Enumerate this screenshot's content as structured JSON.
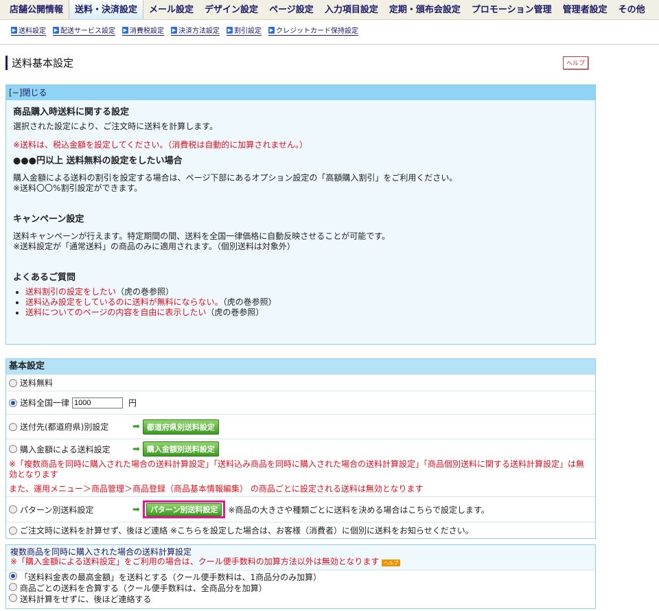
{
  "nav": {
    "tabs": [
      "店舗公開情報",
      "送料・決済設定",
      "メール設定",
      "デザイン設定",
      "ページ設定",
      "入力項目設定",
      "定期・頒布会設定",
      "プロモーション管理",
      "管理者設定",
      "その他"
    ],
    "active": 1
  },
  "subnav": [
    "送料設定",
    "配送サービス設定",
    "消費税設定",
    "決済方法設定",
    "割引設定",
    "クレジットカード保持設定"
  ],
  "page": {
    "title": "送料基本設定",
    "help": "ヘルプ"
  },
  "info": {
    "toggle": "[−]",
    "close": "閉じる",
    "h1": "商品購入時送料に関する設定",
    "p1": "選択された設定により、ご注文時に送料を計算します。",
    "warn": "※送料は、税込金額を設定してください。（消費税は自動的に加算されません。）",
    "h2": "●●●円以上 送料無料の設定をしたい場合",
    "p2a": "購入金額による送料の割引を設定する場合は、ページ下部にあるオプション設定の「高額購入割引」をご利用ください。",
    "p2b": "※送料〇〇%割引設定ができます。",
    "h3": "キャンペーン設定",
    "p3a": "送料キャンペーンが行えます。特定期間の間、送料を全国一律価格に自動反映させることが可能です。",
    "p3b": "※送料設定が「通常送料」の商品のみに適用されます。（個別送料は対象外）",
    "h4": "よくあるご質問",
    "faq": [
      {
        "link": "送料割引の設定をしたい",
        "note": "（虎の巻参照）"
      },
      {
        "link": "送料込み設定をしているのに送料が無料にならない。",
        "note": "（虎の巻参照）"
      },
      {
        "link": "送料についてのページの内容を自由に表示したい",
        "note": "（虎の巻参照）"
      }
    ]
  },
  "basic": {
    "header": "基本設定",
    "free": "送料無料",
    "flat": "送料全国一律",
    "flat_value": "1000",
    "yen": "円",
    "pref": "送付先(都道府県)別設定",
    "pref_btn": "都道府県別送料設定",
    "amount": "購入金額による送料設定",
    "amount_btn": "購入金額別送料設定",
    "amount_note1": "※「複数商品を同時に購入された場合の送料計算設定」「送料込み商品を同時に購入された場合の送料計算設定」「商品個別送料に関する送料計算設定」は無効となります",
    "amount_note2": "また、運用メニュー＞商品管理＞商品登録（商品基本情報編集） の商品ごとに設定される送料は無効となります",
    "pattern": "パターン別送料設定",
    "pattern_btn": "パターン別送料設定",
    "pattern_note": "※商品の大きさや種類ごとに送料を決める場合はこちらで設定します。",
    "later": "ご注文時に送料を計算せず、後ほど連絡 ※こちらを設定した場合は、お客様（消費者）に個別に送料をお知らせください。"
  },
  "multi": {
    "title": "複数商品を同時に購入された場合の送料計算設定",
    "warn": "※「購入金額による送料設定」をご利用の場合は、クール便手数料の加算方法以外は無効となります",
    "help": "ヘルプ",
    "options": [
      "「送料料金表の最高金額」を送料とする（クール便手数料は、1商品分のみ加算）",
      "商品ごとの送料を合算する（クール便手数料は、全商品分を加算）",
      "送料計算をせずに、後ほど連絡する"
    ],
    "selected": 0
  },
  "colors": {
    "accent": "#8fd3f5",
    "red": "#e0101e",
    "highlight": "#e8168c"
  }
}
